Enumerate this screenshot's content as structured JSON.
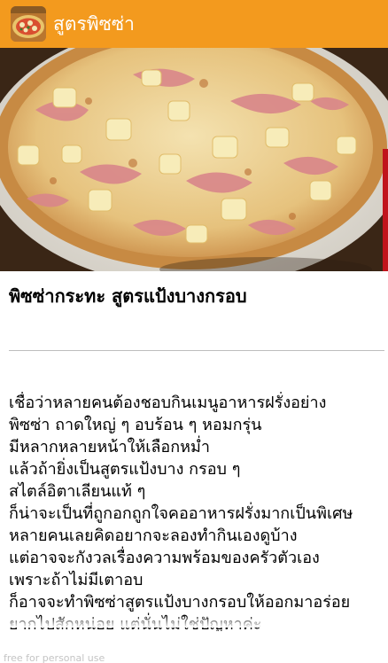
{
  "app_bar": {
    "title": "สูตรพิซซ่า",
    "icon": "pizza-app-icon",
    "background": "#f39a1e"
  },
  "hero": {
    "image": "hawaiian-pizza-photo",
    "scroll_indicator_color": "#c0141c"
  },
  "article": {
    "title": "พิซซ่ากระทะ สูตรแป้งบางกรอบ",
    "body_lines": [
      "เชื่อว่าหลายคนต้องชอบกินเมนูอาหารฝรั่งอย่าง",
      "พิซซ่า ถาดใหญ่ ๆ อบร้อน ๆ หอมกรุ่น",
      "มีหลากหลายหน้าให้เลือกหม่ำ",
      "แล้วถ้ายิ่งเป็นสูตรแป้งบาง กรอบ ๆ",
      "สไตล์อิตาเลียนแท้ ๆ",
      "ก็น่าจะเป็นที่ถูกอกถูกใจคออาหารฝรั่งมากเป็นพิเศษ",
      "หลายคนเลยคิดอยากจะลองทำกินเองดูบ้าง",
      "แต่อาจจะกังวลเรื่องความพร้อมของครัวตัวเอง",
      "เพราะถ้าไม่มีเตาอบ",
      "ก็อาจจะทำพิซซ่าสูตรแป้งบางกรอบให้ออกมาอร่อย",
      "ยากไปสักหน่อย แต่นั่นไม่ใช่ปัญหาค่ะ"
    ]
  },
  "footer": {
    "watermark": "free for personal use"
  }
}
